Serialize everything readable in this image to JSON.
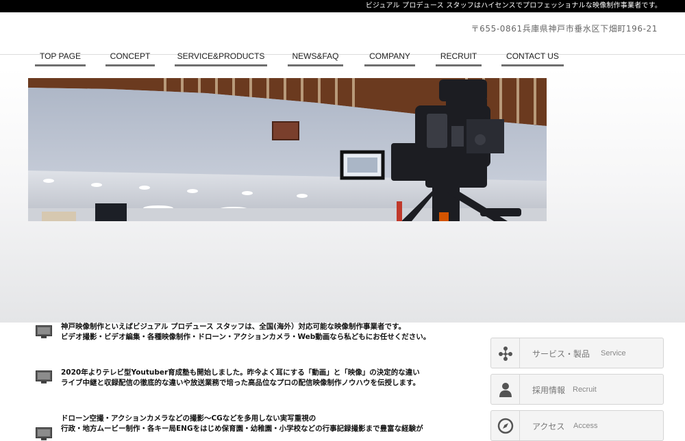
{
  "header": {
    "tagline": "ビジュアル プロデュース スタッフはハイセンスでプロフェッショナルな映像制作事業者です。",
    "address": "〒655-0861兵庫県神戸市垂水区下畑町196-21"
  },
  "nav": {
    "items": [
      {
        "label": "TOP PAGE"
      },
      {
        "label": "CONCEPT"
      },
      {
        "label": "SERVICE&PRODUCTS"
      },
      {
        "label": "NEWS&FAQ"
      },
      {
        "label": "COMPANY"
      },
      {
        "label": "RECRUIT"
      },
      {
        "label": "CONTACT US"
      }
    ]
  },
  "content": {
    "items": [
      {
        "line1": "神戸映像制作といえばビジュアル プロデュース スタッフは、全国(海外）対応可能な映像制作事業者です。",
        "line2": "ビデオ撮影・ビデオ編集・各種映像制作・ドローン・アクションカメラ・Web動画なら私どもにお任せください。"
      },
      {
        "line1": "2020年よりテレビ型Youtuber育成塾も開始しました。昨今よく耳にする「動画」と「映像」の決定的な違い",
        "line2": "ライブ中継と収録配信の徹底的な違いや放送業務で培った高品位なプロの配信映像制作ノウハウを伝授します。"
      },
      {
        "line1": "ドローン空撮・アクションカメラなどの撮影〜CGなどを多用しない実写重視の",
        "line2": "行政・地方ムービー制作・各キー局ENGをはじめ保育園・幼稚園・小学校などの行事記録撮影まで豊富な経験が"
      }
    ]
  },
  "sidebar": {
    "buttons": [
      {
        "label_jp": "サービス・製品",
        "label_en": "Service",
        "icon": "network-icon"
      },
      {
        "label_jp": "採用情報",
        "label_en": "Recruit",
        "icon": "person-icon"
      },
      {
        "label_jp": "アクセス",
        "label_en": "Access",
        "icon": "compass-icon"
      }
    ]
  },
  "colors": {
    "topbar": "#000000",
    "nav_underline": "#6e6e6e",
    "sidebar_bg": "#f4f4f4",
    "icon": "#555555"
  }
}
